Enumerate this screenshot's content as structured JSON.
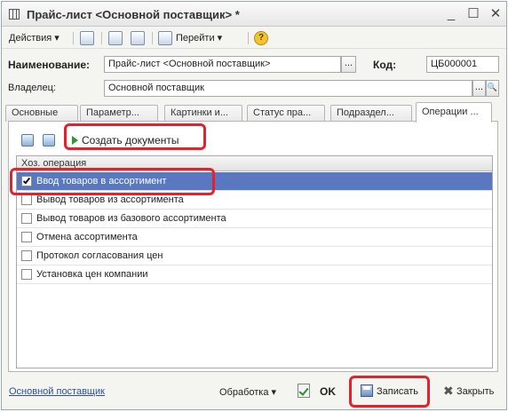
{
  "window": {
    "title": "Прайс-лист <Основной поставщик> *",
    "minimize": "_",
    "maximize": "☐",
    "close": "✕"
  },
  "toolbar": {
    "actions_label": "Действия ▾",
    "goto_label": "Перейти ▾",
    "help_label": "?"
  },
  "form": {
    "name_label": "Наименование:",
    "name_value": "Прайс-лист <Основной поставщик>",
    "name_select": "...",
    "code_label": "Код:",
    "code_value": "ЦБ000001",
    "owner_label": "Владелец:",
    "owner_value": "Основной поставщик",
    "owner_select": "...",
    "owner_open": "🔍"
  },
  "tabs": [
    {
      "label": "Основные"
    },
    {
      "label": "Параметр..."
    },
    {
      "label": "Картинки и..."
    },
    {
      "label": "Статус пра..."
    },
    {
      "label": "Подраздел..."
    },
    {
      "label": "Операции ..."
    }
  ],
  "operations": {
    "create_docs_label": "Создать документы",
    "column_header": "Хоз. операция",
    "rows": [
      {
        "label": "Ввод товаров в ассортимент",
        "checked": true
      },
      {
        "label": "Вывод товаров из ассортимента",
        "checked": false
      },
      {
        "label": "Вывод товаров из базового ассортимента",
        "checked": false
      },
      {
        "label": "Отмена ассортимента",
        "checked": false
      },
      {
        "label": "Протокол согласования цен",
        "checked": false
      },
      {
        "label": "Установка цен компании",
        "checked": false
      }
    ]
  },
  "footer": {
    "owner_link": "Основной поставщик",
    "processing_label": "Обработка ▾",
    "ok_label": "OK",
    "save_label": "Записать",
    "close_label": "Закрыть"
  },
  "colors": {
    "selection": "#5a78c0",
    "highlight": "#e8202a",
    "link": "#2c4fa0"
  }
}
